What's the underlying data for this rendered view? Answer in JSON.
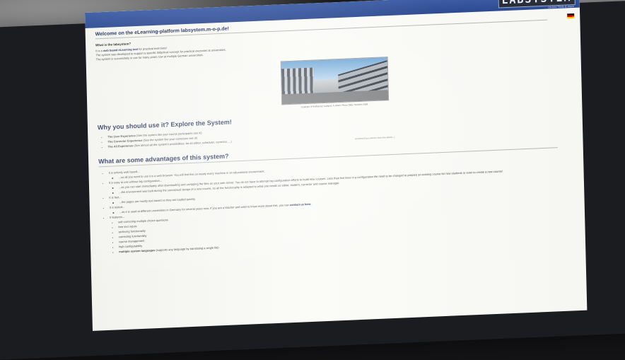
{
  "site": {
    "logo_text": "LABSYSTEM",
    "logo_subtitle": "on-line Tests & more",
    "language_flag": "de-flag"
  },
  "welcome": {
    "title": "Welcome on the eLearning-platform labsystem.m-o-p.de!",
    "what_heading": "What is the labsystem?",
    "intro_prefix": "It is a ",
    "intro_highlight": "web based eLearning tool",
    "intro_suffix": " for practical exercises!",
    "line2": "The system was developed to support a specific didactical concept for practical exercises at universities.",
    "line3": "The system is successfully in use for many years now at multiple German universities.",
    "photo_caption": "Example of Wolfsburg / Campus, A. Mohn: Photo 2005 / Summer 2006"
  },
  "why": {
    "heading": "Why you should use it? Explore the System!",
    "items": [
      {
        "label": "The User Experience",
        "rest": " (See the system like your course participants see it!)"
      },
      {
        "label": "The Corrector Experience",
        "rest": " (See the system like your correctors see it!)"
      },
      {
        "label": "The All Experience",
        "rest": " (See almost all the system's possibilities: be an editor, scheduler, corrector, ...)"
      }
    ],
    "tour_link": "(a tutorial if you want to learn the details...)"
  },
  "advantages": {
    "heading": "What are some advantages of this system?",
    "items": [
      {
        "text": "It is entirely web based...",
        "sub": [
          "...so all you need to use it is a web browser. You will find this on nearly every machine in an educational environment."
        ]
      },
      {
        "text": "It is easy to use without big configuration...",
        "sub": [
          "...as you can start immediately after downloading and unzipping the files on your web server. You do not have to attempt big configuration efforts to build new courses. Less than five lines in a configuration file need to be changed to prepare an existing course for new students or even to create a new course!",
          "...the environment was built during the conceptual design of a new course, so all the functionality is adapted to what one needs as editor, student, corrector and course manager."
        ]
      },
      {
        "text": "It is fast...",
        "sub": [
          "...the pages are mostly text based so they are loaded quickly."
        ]
      },
      {
        "text": "It is tested...",
        "sub_prefix": "...as it is used at different universities in Germany for several years now. If you are a teacher and want to know more about this, you can ",
        "sub_link": "contact us here",
        "sub_suffix": "."
      },
      {
        "text": "It features...",
        "features": [
          "self correcting multiple choice questions",
          "free text inputs",
          "archiving functionality",
          "correcting functionality",
          "course management",
          "high configurability"
        ],
        "last_feature_bold": "multiple system languages",
        "last_feature_rest": " (supports any language by translating a single file)"
      }
    ]
  }
}
